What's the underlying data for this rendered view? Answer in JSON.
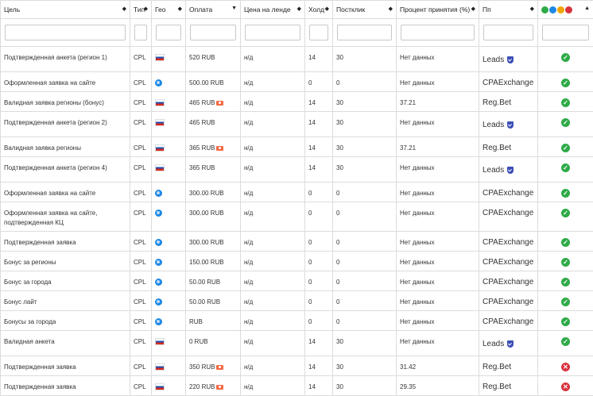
{
  "columns": [
    {
      "label": "Цель"
    },
    {
      "label": "Тип"
    },
    {
      "label": "Гео"
    },
    {
      "label": "Оплата"
    },
    {
      "label": "Цена на ленде"
    },
    {
      "label": "Холд"
    },
    {
      "label": "Постклик"
    },
    {
      "label": "Процент принятия (%)"
    },
    {
      "label": "Пп"
    }
  ],
  "sort_icons": [
    "◆",
    "◆",
    "◆",
    "▼",
    "◆",
    "◆",
    "◆",
    "◆",
    "◆",
    "▲"
  ],
  "status_header_colors": [
    "#2eaa47",
    "#1e88e5",
    "#f0a500",
    "#d9343f"
  ],
  "rows": [
    {
      "goal": "Подтвержденная анкета (регион 1)",
      "type": "CPL",
      "geo": "ru",
      "pay": "520 RUB",
      "pay_badge": false,
      "land": "н/д",
      "hold": "14",
      "postclick": "30",
      "accept": "Нет данных",
      "pp": "Leads",
      "pp_shield": true,
      "status": "ok",
      "h": "r28"
    },
    {
      "goal": "Оформленная заявка на сайте",
      "type": "CPL",
      "geo": "world",
      "pay": "500.00 RUB",
      "pay_badge": false,
      "land": "н/д",
      "hold": "0",
      "postclick": "0",
      "accept": "Нет данных",
      "pp": "CPAExchange",
      "pp_shield": false,
      "status": "ok",
      "h": "r24"
    },
    {
      "goal": "Валидная заявка регионы (бонус)",
      "type": "CPL",
      "geo": "ru",
      "pay": "465 RUB",
      "pay_badge": true,
      "land": "н/д",
      "hold": "14",
      "postclick": "30",
      "accept": "37.21",
      "pp": "Reg.Bet",
      "pp_shield": false,
      "status": "ok",
      "h": "r24"
    },
    {
      "goal": "Подтвержденная анкета (регион 2)",
      "type": "CPL",
      "geo": "ru",
      "pay": "465 RUB",
      "pay_badge": false,
      "land": "н/д",
      "hold": "14",
      "postclick": "30",
      "accept": "Нет данных",
      "pp": "Leads",
      "pp_shield": true,
      "status": "ok",
      "h": "r28"
    },
    {
      "goal": "Валидная заявка регионы",
      "type": "CPL",
      "geo": "ru",
      "pay": "365 RUB",
      "pay_badge": true,
      "land": "н/д",
      "hold": "14",
      "postclick": "30",
      "accept": "37.21",
      "pp": "Reg.Bet",
      "pp_shield": false,
      "status": "ok",
      "h": "r24"
    },
    {
      "goal": "Подтвержденная анкета (регион 4)",
      "type": "CPL",
      "geo": "ru",
      "pay": "365 RUB",
      "pay_badge": false,
      "land": "н/д",
      "hold": "14",
      "postclick": "30",
      "accept": "Нет данных",
      "pp": "Leads",
      "pp_shield": true,
      "status": "ok",
      "h": "r28"
    },
    {
      "goal": "Оформленная заявка на сайте",
      "type": "CPL",
      "geo": "world",
      "pay": "300.00 RUB",
      "pay_badge": false,
      "land": "н/д",
      "hold": "0",
      "postclick": "0",
      "accept": "Нет данных",
      "pp": "CPAExchange",
      "pp_shield": false,
      "status": "ok",
      "h": "r24"
    },
    {
      "goal": "Оформленная заявка на сайте, подтвержденная КЦ",
      "type": "CPL",
      "geo": "world",
      "pay": "300.00 RUB",
      "pay_badge": false,
      "land": "н/д",
      "hold": "0",
      "postclick": "0",
      "accept": "Нет данных",
      "pp": "CPAExchange",
      "pp_shield": false,
      "status": "ok",
      "h": "r36"
    },
    {
      "goal": "Подтвержденная заявка",
      "type": "CPL",
      "geo": "world",
      "pay": "300.00 RUB",
      "pay_badge": false,
      "land": "н/д",
      "hold": "0",
      "postclick": "0",
      "accept": "Нет данных",
      "pp": "CPAExchange",
      "pp_shield": false,
      "status": "ok",
      "h": "r24"
    },
    {
      "goal": "Бонус за регионы",
      "type": "CPL",
      "geo": "world",
      "pay": "150.00 RUB",
      "pay_badge": false,
      "land": "н/д",
      "hold": "0",
      "postclick": "0",
      "accept": "Нет данных",
      "pp": "CPAExchange",
      "pp_shield": false,
      "status": "ok",
      "h": "r24"
    },
    {
      "goal": "Бонус за города",
      "type": "CPL",
      "geo": "world",
      "pay": "50.00 RUB",
      "pay_badge": false,
      "land": "н/д",
      "hold": "0",
      "postclick": "0",
      "accept": "Нет данных",
      "pp": "CPAExchange",
      "pp_shield": false,
      "status": "ok",
      "h": "r24"
    },
    {
      "goal": "Бонус лайт",
      "type": "CPL",
      "geo": "world",
      "pay": "50.00 RUB",
      "pay_badge": false,
      "land": "н/д",
      "hold": "0",
      "postclick": "0",
      "accept": "Нет данных",
      "pp": "CPAExchange",
      "pp_shield": false,
      "status": "ok",
      "h": "r24"
    },
    {
      "goal": "Бонусы за города",
      "type": "CPL",
      "geo": "world",
      "pay": "RUB",
      "pay_badge": false,
      "land": "н/д",
      "hold": "0",
      "postclick": "0",
      "accept": "Нет данных",
      "pp": "CPAExchange",
      "pp_shield": false,
      "status": "ok",
      "h": "r24"
    },
    {
      "goal": "Валидная анкета",
      "type": "CPL",
      "geo": "ru",
      "pay": "0 RUB",
      "pay_badge": false,
      "land": "н/д",
      "hold": "14",
      "postclick": "30",
      "accept": "Нет данных",
      "pp": "Leads",
      "pp_shield": true,
      "status": "ok",
      "h": "r28"
    },
    {
      "goal": "Подтвержденная заявка",
      "type": "CPL",
      "geo": "ru",
      "pay": "350 RUB",
      "pay_badge": true,
      "land": "н/д",
      "hold": "14",
      "postclick": "30",
      "accept": "31.42",
      "pp": "Reg.Bet",
      "pp_shield": false,
      "status": "err",
      "h": "r24"
    },
    {
      "goal": "Подтвержденная заявка",
      "type": "CPL",
      "geo": "ru",
      "pay": "220 RUB",
      "pay_badge": true,
      "land": "н/д",
      "hold": "14",
      "postclick": "30",
      "accept": "29.35",
      "pp": "Reg.Bet",
      "pp_shield": false,
      "status": "err",
      "h": "r24"
    }
  ]
}
